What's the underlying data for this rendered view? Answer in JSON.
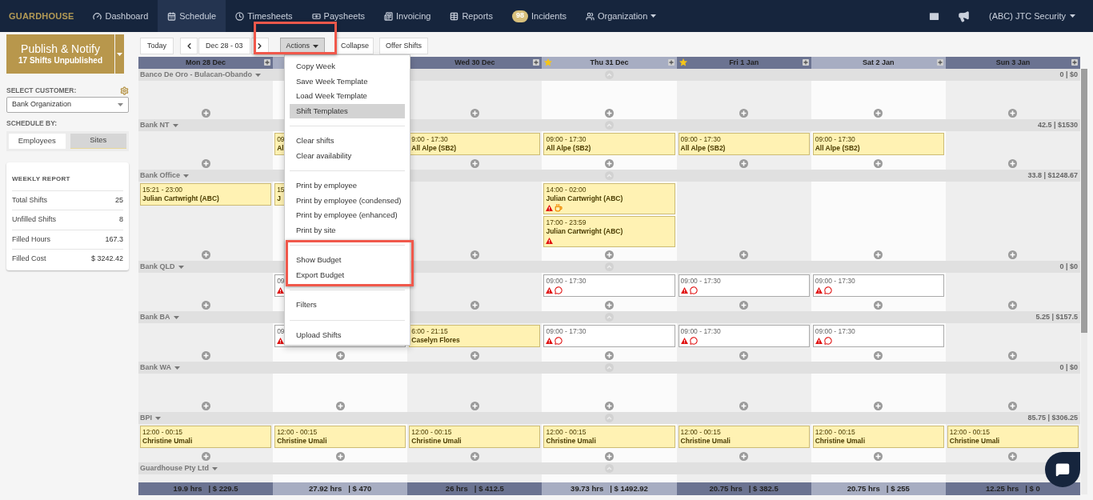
{
  "nav": {
    "logo": "GUARDHOUSE",
    "items": [
      {
        "label": "Dashboard",
        "selected": false
      },
      {
        "label": "Schedule",
        "selected": true
      },
      {
        "label": "Timesheets",
        "selected": false
      },
      {
        "label": "Paysheets",
        "selected": false
      },
      {
        "label": "Invoicing",
        "selected": false
      },
      {
        "label": "Reports",
        "selected": false
      },
      {
        "label": "Incidents",
        "badge": "98",
        "selected": false
      },
      {
        "label": "Organization",
        "dropdown": true,
        "selected": false
      }
    ],
    "account": "(ABC) JTC Security"
  },
  "sidebar": {
    "publish": {
      "title": "Publish & Notify",
      "subtitle": "17 Shifts Unpublished"
    },
    "customer_label": "SELECT CUSTOMER:",
    "customer": "Bank Organization",
    "schedule_by_label": "SCHEDULE BY:",
    "schedule_by": [
      {
        "label": "Employees",
        "selected": false
      },
      {
        "label": "Sites",
        "selected": true
      }
    ],
    "report": {
      "title": "WEEKLY REPORT",
      "rows": [
        {
          "label": "Total Shifts",
          "value": "25"
        },
        {
          "label": "Unfilled Shifts",
          "value": "8"
        },
        {
          "label": "Filled Hours",
          "value": "167.3"
        },
        {
          "label": "Filled Cost",
          "value": "$ 3242.42"
        }
      ]
    }
  },
  "toolbar": {
    "today": "Today",
    "range": "Dec 28 - 03",
    "actions": "Actions",
    "collapse": "Collapse",
    "offer": "Offer Shifts"
  },
  "days": [
    {
      "label": "Mon 28 Dec",
      "starred": false
    },
    {
      "starred": false
    },
    {
      "label": "Wed 30 Dec",
      "starred": false
    },
    {
      "label": "Thu 31 Dec",
      "starred": true
    },
    {
      "label": "Fri 1 Jan",
      "starred": true
    },
    {
      "label": "Sat 2 Jan",
      "starred": false
    },
    {
      "label": "Sun 3 Jan",
      "starred": false
    }
  ],
  "sites": [
    {
      "name": "Banco De Oro - Bulacan-Obando",
      "total": "0 | $0"
    },
    {
      "name": "Bank NT",
      "total": "42.5 | $1530",
      "days": {
        "tue": [
          {
            "time": "09",
            "name": "Al",
            "filled": true
          }
        ],
        "wed": [
          {
            "time": "9:00 - 17:30",
            "name": "All Alpe (SB2)",
            "filled": true
          }
        ],
        "thu": [
          {
            "time": "09:00 - 17:30",
            "name": "All Alpe (SB2)",
            "filled": true
          }
        ],
        "fri": [
          {
            "time": "09:00 - 17:30",
            "name": "All Alpe (SB2)",
            "filled": true
          }
        ],
        "sat": [
          {
            "time": "09:00 - 17:30",
            "name": "All Alpe (SB2)",
            "filled": true
          }
        ]
      }
    },
    {
      "name": "Bank Office",
      "total": "33.8 | $1248.67",
      "days": {
        "mon": [
          {
            "time": "15:21 - 23:00",
            "name": "Julian Cartwright (ABC)",
            "filled": true
          }
        ],
        "tue": [
          {
            "time": "15",
            "name": "J",
            "filled": true
          }
        ],
        "thu": [
          {
            "time": "14:00 - 02:00",
            "name": "Julian Cartwright (ABC)",
            "filled": true,
            "warning": true,
            "break": true
          },
          {
            "time": "17:00 - 23:59",
            "name": "Julian Cartwright (ABC)",
            "filled": true,
            "warning": true
          }
        ]
      }
    },
    {
      "name": "Bank QLD",
      "total": "0 | $0",
      "days": {
        "tue": [
          {
            "time": "09",
            "filled": false,
            "warning": true
          }
        ],
        "thu": [
          {
            "time": "09:00 - 17:30",
            "filled": false,
            "warning": true,
            "comment": true
          }
        ],
        "fri": [
          {
            "time": "09:00 - 17:30",
            "filled": false,
            "warning": true,
            "comment": true
          }
        ],
        "sat": [
          {
            "time": "09:00 - 17:30",
            "filled": false,
            "warning": true,
            "comment": true
          }
        ]
      }
    },
    {
      "name": "Bank BA",
      "total": "5.25 | $157.5",
      "days": {
        "tue": [
          {
            "time": "09",
            "filled": false,
            "warning": true
          }
        ],
        "wed": [
          {
            "time": "6:00 - 21:15",
            "name": "Caselyn Flores",
            "filled": true
          }
        ],
        "thu": [
          {
            "time": "09:00 - 17:30",
            "filled": false,
            "warning": true,
            "comment": true
          }
        ],
        "fri": [
          {
            "time": "09:00 - 17:30",
            "filled": false,
            "warning": true,
            "comment": true
          }
        ],
        "sat": [
          {
            "time": "09:00 - 17:30",
            "filled": false,
            "warning": true,
            "comment": true
          }
        ]
      }
    },
    {
      "name": "Bank WA",
      "total": "0 | $0"
    },
    {
      "name": "BPI",
      "total": "85.75 | $306.25",
      "days": {
        "mon": [
          {
            "time": "12:00 - 00:15",
            "name": "Christine Umali",
            "filled": true
          }
        ],
        "tue": [
          {
            "time": "12:00 - 00:15",
            "name": "Christine Umali",
            "filled": true
          }
        ],
        "wed": [
          {
            "time": "12:00 - 00:15",
            "name": "Christine Umali",
            "filled": true
          }
        ],
        "thu": [
          {
            "time": "12:00 - 00:15",
            "name": "Christine Umali",
            "filled": true
          }
        ],
        "fri": [
          {
            "time": "12:00 - 00:15",
            "name": "Christine Umali",
            "filled": true
          }
        ],
        "sat": [
          {
            "time": "12:00 - 00:15",
            "name": "Christine Umali",
            "filled": true
          }
        ],
        "sun": [
          {
            "time": "12:00 - 00:15",
            "name": "Christine Umali",
            "filled": true
          }
        ]
      }
    },
    {
      "name": "Guardhouse Pty Ltd"
    }
  ],
  "totals": [
    {
      "hours": "19.9 hrs",
      "cost": "| $ 229.5"
    },
    {
      "hours": "27.92 hrs",
      "cost": "| $ 470"
    },
    {
      "hours": "26 hrs",
      "cost": "| $ 412.5"
    },
    {
      "hours": "39.73 hrs",
      "cost": "| $ 1492.92"
    },
    {
      "hours": "20.75 hrs",
      "cost": "| $ 382.5"
    },
    {
      "hours": "20.75 hrs",
      "cost": "| $ 255"
    },
    {
      "hours": "12.25 hrs",
      "cost": "| $ 0"
    }
  ],
  "actions_menu": [
    [
      {
        "label": "Copy Week",
        "selected": false
      },
      {
        "label": "Save Week Template",
        "selected": false
      },
      {
        "label": "Load Week Template",
        "selected": false
      },
      {
        "label": "Shift Templates",
        "selected": true
      }
    ],
    [
      {
        "label": "Clear shifts",
        "selected": false
      },
      {
        "label": "Clear availability",
        "selected": false
      }
    ],
    [
      {
        "label": "Print by employee",
        "selected": false
      },
      {
        "label": "Print by employee (condensed)",
        "selected": false
      },
      {
        "label": "Print by employee (enhanced)",
        "selected": false
      },
      {
        "label": "Print by site",
        "selected": false
      }
    ],
    [
      {
        "label": "Show Budget",
        "selected": false
      },
      {
        "label": "Export Budget",
        "selected": false
      }
    ],
    [
      {
        "label": "Filters",
        "selected": false
      }
    ],
    [
      {
        "label": "Upload Shifts",
        "selected": false
      }
    ]
  ]
}
